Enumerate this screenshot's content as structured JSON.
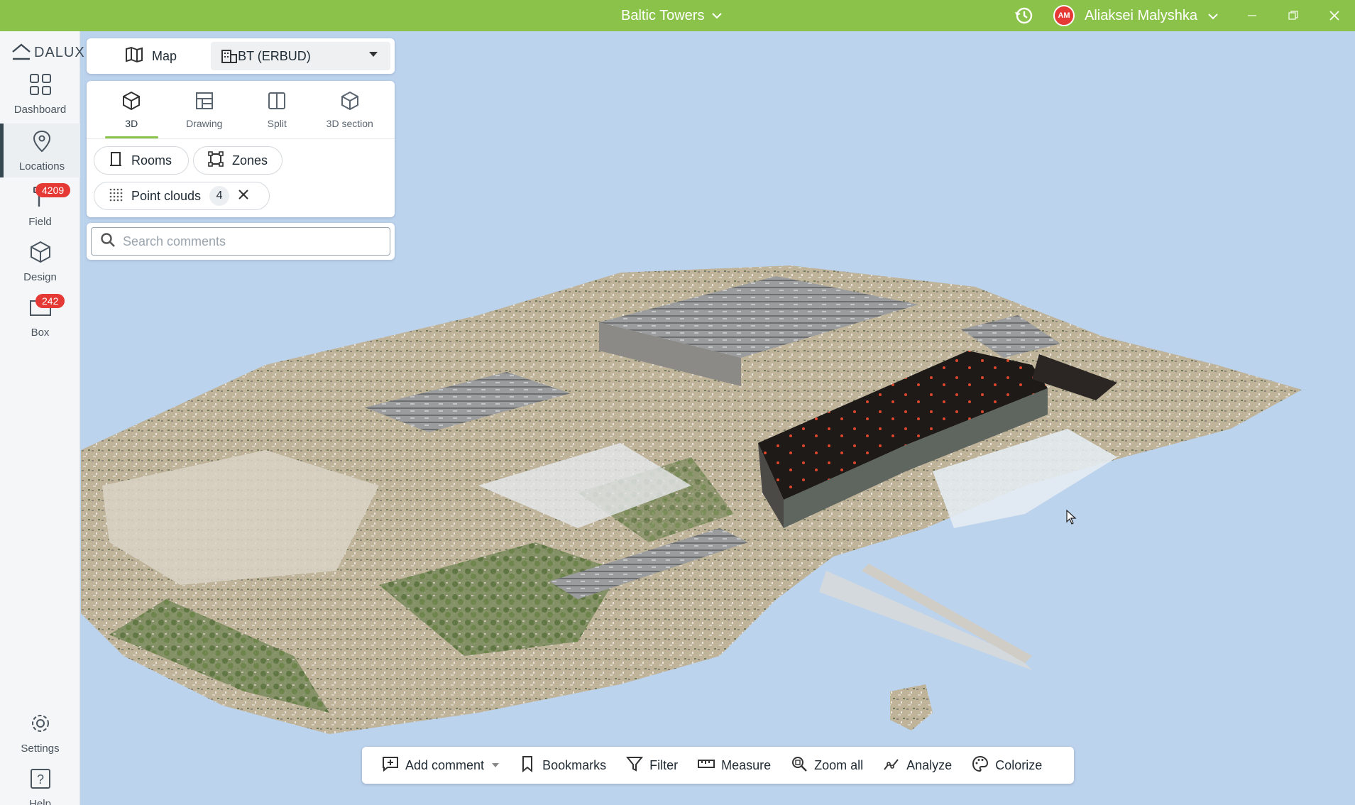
{
  "titlebar": {
    "project": "Baltic Towers",
    "avatar_initials": "AM",
    "username": "Aliaksei Malyshka",
    "bg_color": "#8bc34a"
  },
  "sidebar": {
    "logo": "DALUX",
    "items": [
      {
        "label": "Dashboard",
        "icon": "dashboard-grid-icon"
      },
      {
        "label": "Locations",
        "icon": "location-pin-icon",
        "active": true
      },
      {
        "label": "Field",
        "icon": "hammer-icon",
        "badge": "4209"
      },
      {
        "label": "Design",
        "icon": "cube-icon"
      },
      {
        "label": "Box",
        "icon": "folder-icon",
        "badge": "242"
      },
      {
        "label": "Settings",
        "icon": "gear-icon"
      },
      {
        "label": "Help",
        "icon": "help-icon"
      }
    ]
  },
  "panel": {
    "map_label": "Map",
    "building_select": "BT (ERBUD)",
    "views": [
      {
        "label": "3D",
        "icon": "cube-icon",
        "active": true
      },
      {
        "label": "Drawing",
        "icon": "drawing-icon"
      },
      {
        "label": "Split",
        "icon": "split-icon"
      },
      {
        "label": "3D section",
        "icon": "cube-section-icon"
      }
    ],
    "rooms_label": "Rooms",
    "zones_label": "Zones",
    "point_clouds_label": "Point clouds",
    "point_clouds_count": "4",
    "search_placeholder": "Search comments"
  },
  "toolbar": {
    "add_comment": "Add comment",
    "bookmarks": "Bookmarks",
    "filter": "Filter",
    "measure": "Measure",
    "zoom_all": "Zoom all",
    "analyze": "Analyze",
    "colorize": "Colorize"
  },
  "colors": {
    "accent": "#8bc34a",
    "badge": "#e53935",
    "sky": "#bcd3ee"
  }
}
